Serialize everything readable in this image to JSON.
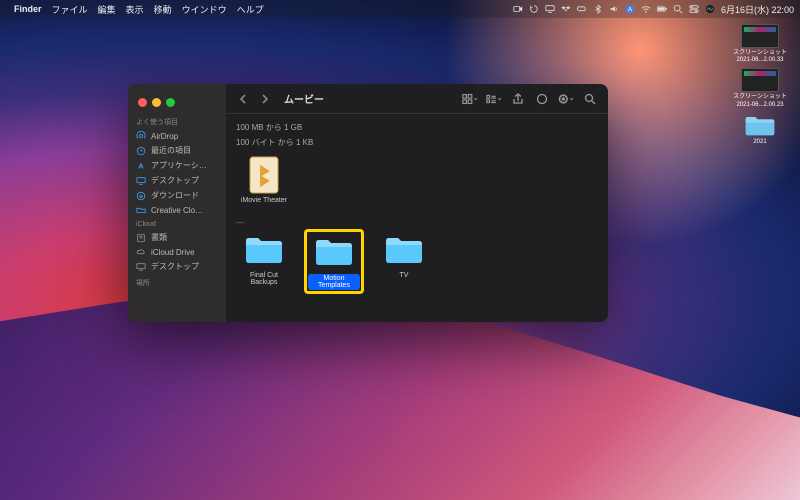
{
  "menubar": {
    "app": "Finder",
    "items": [
      "ファイル",
      "編集",
      "表示",
      "移動",
      "ウインドウ",
      "ヘルプ"
    ],
    "clock": "6月16日(水)  22:00"
  },
  "desktop": {
    "items": [
      {
        "kind": "screenshot",
        "label": "スクリーンショット 2021-06...2.00.33"
      },
      {
        "kind": "screenshot",
        "label": "スクリーンショット 2021-06...2.00.23"
      },
      {
        "kind": "folder",
        "label": "2021"
      }
    ]
  },
  "finder": {
    "toolbar": {
      "title": "ムービー"
    },
    "sidebar": {
      "favorites_header": "よく使う項目",
      "favorites": [
        {
          "icon": "airdrop",
          "label": "AirDrop",
          "color": "#3a9ff5"
        },
        {
          "icon": "clock",
          "label": "最近の項目",
          "color": "#3a9ff5"
        },
        {
          "icon": "apps",
          "label": "アプリケーシ…",
          "color": "#3a9ff5"
        },
        {
          "icon": "desktop",
          "label": "デスクトップ",
          "color": "#3a9ff5"
        },
        {
          "icon": "download",
          "label": "ダウンロード",
          "color": "#3a9ff5"
        },
        {
          "icon": "folder",
          "label": "Creative Clo…",
          "color": "#3a9ff5"
        }
      ],
      "icloud_header": "iCloud",
      "icloud": [
        {
          "icon": "book",
          "label": "書類",
          "color": "#8e8e93"
        },
        {
          "icon": "cloud",
          "label": "iCloud Drive",
          "color": "#8e8e93"
        },
        {
          "icon": "desktop",
          "label": "デスクトップ",
          "color": "#8e8e93"
        }
      ],
      "locations_header": "場所"
    },
    "groups": [
      {
        "label": "100 MB から 1 GB",
        "items": []
      },
      {
        "label": "100 バイト から 1 KB",
        "items": [
          {
            "type": "theater",
            "label": "iMovie Theater",
            "selected": false
          }
        ]
      },
      {
        "label": "---",
        "items": [
          {
            "type": "folder",
            "label": "Final Cut Backups",
            "selected": false
          },
          {
            "type": "folder",
            "label": "Motion Templates",
            "selected": true,
            "highlighted": true
          },
          {
            "type": "folder",
            "label": "TV",
            "selected": false
          }
        ]
      }
    ]
  }
}
